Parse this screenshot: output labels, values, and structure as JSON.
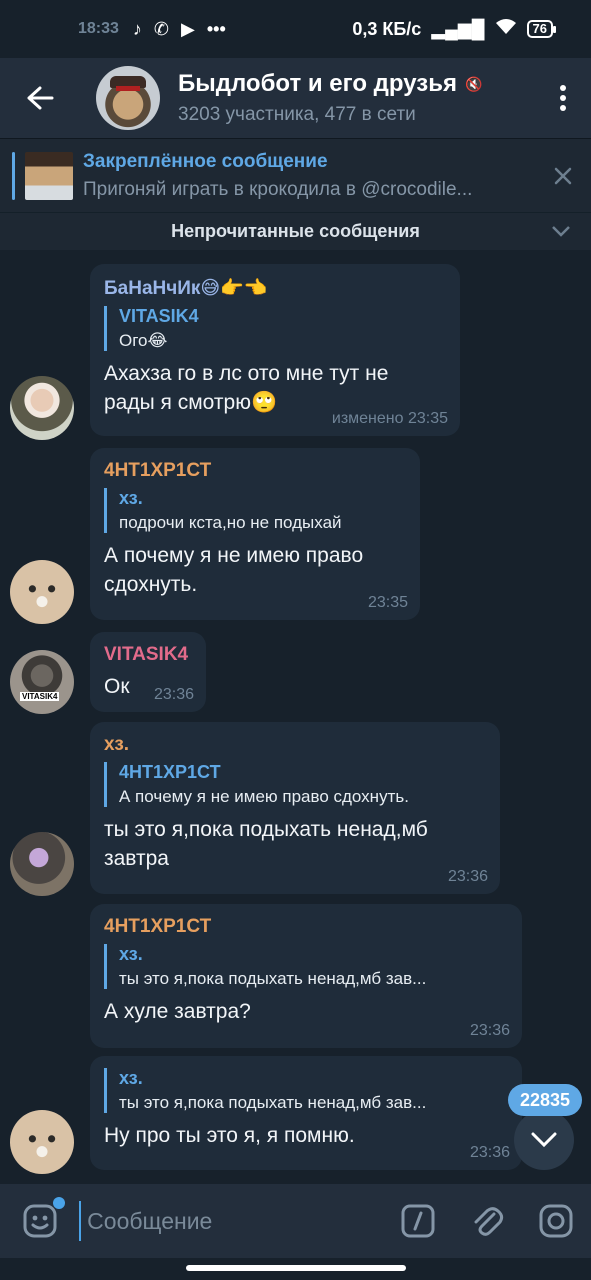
{
  "status_bar": {
    "time": "18:33",
    "net_speed": "0,3 КБ/с",
    "battery": "76"
  },
  "header": {
    "title": "Быдлобот и его друзья",
    "subtitle": "3203 участника, 477 в сети"
  },
  "pinned": {
    "title": "Закреплённое сообщение",
    "text": "Пригоняй играть в крокодила в @crocodile..."
  },
  "unread_label": "Непрочитанные сообщения",
  "messages": [
    {
      "sender": "БаНаНчИк😅👉👈",
      "sender_color": "#9ab6e8",
      "reply_name": "VITASIK4",
      "reply_text": "Ого😂",
      "text": "Ахахза го в лс ото мне тут не рады я смотрю🙄",
      "time": "изменено 23:35"
    },
    {
      "sender": "4НТ1ХР1СТ",
      "sender_color": "#e69f5f",
      "reply_name": "хз.",
      "reply_text": "подрочи кста,но не подыхай",
      "text": "А почему я не имею право сдохнуть.",
      "time": "23:35"
    },
    {
      "sender": "VITASIK4",
      "sender_color": "#e26b8b",
      "text": "Ок",
      "time": "23:36"
    },
    {
      "sender": "хз.",
      "sender_color": "#e69f5f",
      "reply_name": "4НТ1ХР1СТ",
      "reply_text": "А почему я не имею право сдохнуть.",
      "text": "ты это я,пока подыхать ненад,мб завтра",
      "time": "23:36"
    },
    {
      "sender": "4НТ1ХР1СТ",
      "sender_color": "#e69f5f",
      "reply_name": "хз.",
      "reply_text": "ты это я,пока подыхать ненад,мб зав...",
      "text": "А хуле завтра?",
      "time": "23:36"
    },
    {
      "reply_name": "хз.",
      "reply_text": "ты это я,пока подыхать ненад,мб зав...",
      "text": "Ну про ты это я, я помню.",
      "time": "23:36"
    }
  ],
  "unread_count": "22835",
  "composer": {
    "placeholder": "Сообщение"
  },
  "colors": {
    "accent": "#5fa8e5",
    "background": "#17212b",
    "bubble": "#1f2c3a"
  },
  "icons": [
    "back-arrow-icon",
    "more-vert-icon",
    "mute-icon",
    "close-icon",
    "chevron-down-icon",
    "emoji-sticker-icon",
    "bot-command-icon",
    "attach-icon",
    "camera-icon"
  ]
}
